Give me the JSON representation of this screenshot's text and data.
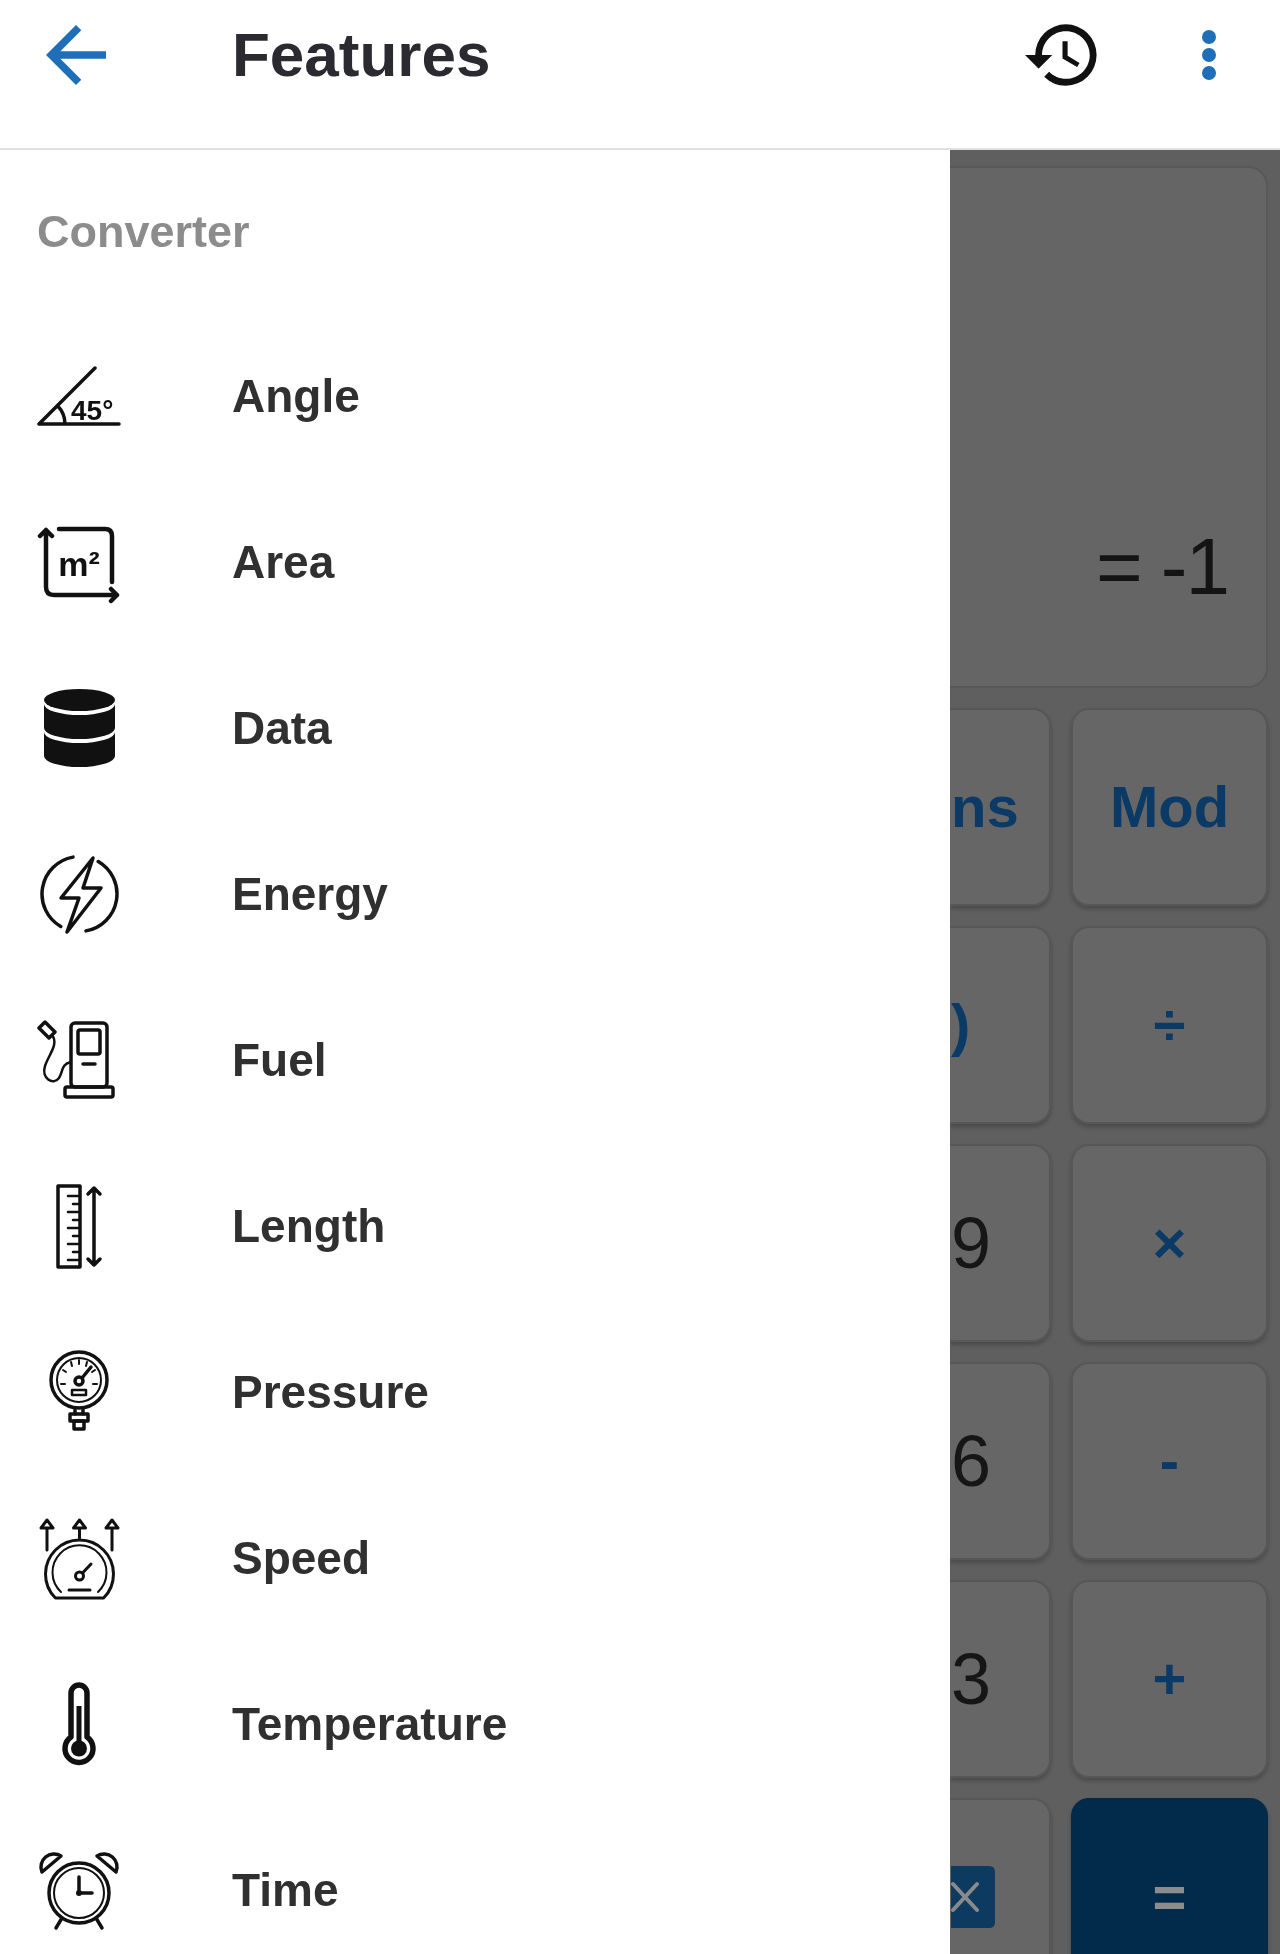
{
  "app_bar": {
    "title": "Features"
  },
  "drawer": {
    "section_title": "Converter",
    "items": [
      {
        "label": "Angle",
        "kind": "angle",
        "icon_text": "45°"
      },
      {
        "label": "Area",
        "kind": "area",
        "icon_text": "m²"
      },
      {
        "label": "Data",
        "kind": "data"
      },
      {
        "label": "Energy",
        "kind": "energy"
      },
      {
        "label": "Fuel",
        "kind": "fuel"
      },
      {
        "label": "Length",
        "kind": "length"
      },
      {
        "label": "Pressure",
        "kind": "pressure"
      },
      {
        "label": "Speed",
        "kind": "speed"
      },
      {
        "label": "Temperature",
        "kind": "temperature"
      },
      {
        "label": "Time",
        "kind": "time"
      }
    ]
  },
  "calculator": {
    "result": "= -1",
    "rows": [
      {
        "keys": [
          {
            "label": "ns",
            "kind": "function"
          },
          {
            "label": "Mod",
            "kind": "operator"
          }
        ]
      },
      {
        "keys": [
          {
            "label": ")",
            "kind": "operator"
          },
          {
            "label": "÷",
            "kind": "operator"
          }
        ]
      },
      {
        "keys": [
          {
            "label": "9",
            "kind": "digit"
          },
          {
            "label": "×",
            "kind": "operator"
          }
        ]
      },
      {
        "keys": [
          {
            "label": "6",
            "kind": "digit"
          },
          {
            "label": "-",
            "kind": "operator"
          }
        ]
      },
      {
        "keys": [
          {
            "label": "3",
            "kind": "digit"
          },
          {
            "label": "+",
            "kind": "operator"
          }
        ]
      },
      {
        "keys": [
          {
            "kind": "backspace"
          },
          {
            "label": "=",
            "kind": "equals"
          }
        ]
      }
    ]
  }
}
